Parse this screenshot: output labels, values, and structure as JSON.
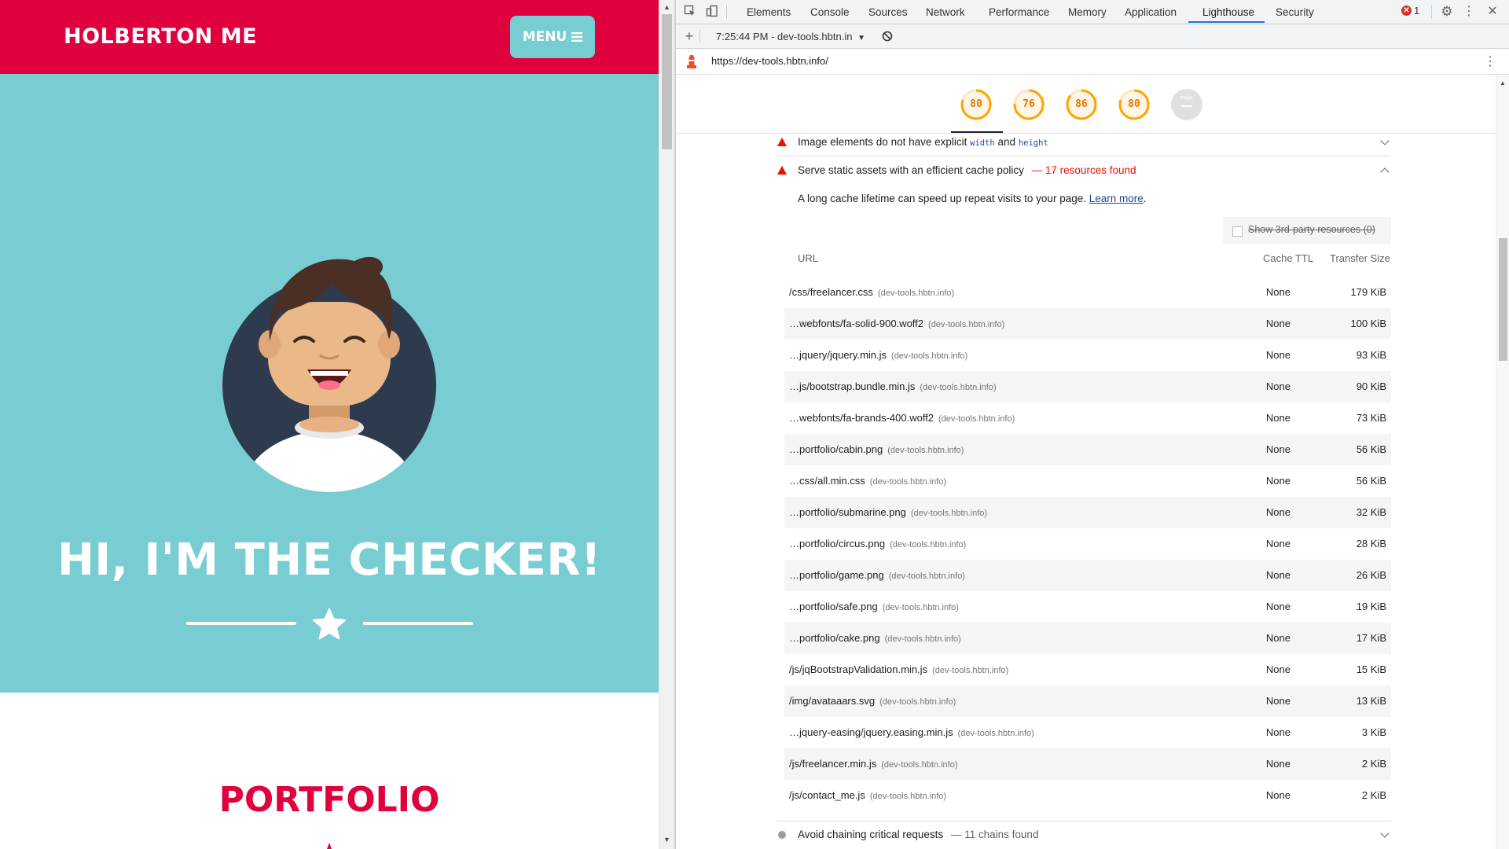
{
  "site": {
    "brand": "HOLBERTON ME",
    "menu_label": "MENU",
    "hero_title": "HI, I'M THE CHECKER!",
    "section_title": "PORTFOLIO"
  },
  "devtools": {
    "tabs": [
      "Elements",
      "Console",
      "Sources",
      "Network",
      "Performance",
      "Memory",
      "Application",
      "Lighthouse",
      "Security"
    ],
    "active_tab": "Lighthouse",
    "error_count": "1",
    "report_selector": "7:25:44 PM - dev-tools.hbtn.in",
    "url": "https://dev-tools.hbtn.info/",
    "scores": [
      "80",
      "76",
      "86",
      "80"
    ],
    "pwa_label": "PWA",
    "colors": {
      "score_average": "#e67700",
      "warn": "#eb0f00",
      "brand_red": "#e0003d",
      "hero_teal": "#78cdd2"
    }
  },
  "audit": {
    "prev_item": {
      "text_before": "Image elements do not have explicit",
      "code1": "width",
      "and": "and",
      "code2": "height"
    },
    "current": {
      "title": "Serve static assets with an efficient cache policy",
      "summary": "— 17 resources found",
      "description": "A long cache lifetime can speed up repeat visits to your page.",
      "learn_more": "Learn more",
      "period": ".",
      "third_party": "Show 3rd-party resources (0)",
      "col_url": "URL",
      "col_ttl": "Cache TTL",
      "col_size": "Transfer Size",
      "rows": [
        {
          "url": "/css/freelancer.css",
          "host": "(dev-tools.hbtn.info)",
          "ttl": "None",
          "size": "179 KiB"
        },
        {
          "url": "…webfonts/fa-solid-900.woff2",
          "host": "(dev-tools.hbtn.info)",
          "ttl": "None",
          "size": "100 KiB"
        },
        {
          "url": "…jquery/jquery.min.js",
          "host": "(dev-tools.hbtn.info)",
          "ttl": "None",
          "size": "93 KiB"
        },
        {
          "url": "…js/bootstrap.bundle.min.js",
          "host": "(dev-tools.hbtn.info)",
          "ttl": "None",
          "size": "90 KiB"
        },
        {
          "url": "…webfonts/fa-brands-400.woff2",
          "host": "(dev-tools.hbtn.info)",
          "ttl": "None",
          "size": "73 KiB"
        },
        {
          "url": "…portfolio/cabin.png",
          "host": "(dev-tools.hbtn.info)",
          "ttl": "None",
          "size": "56 KiB"
        },
        {
          "url": "…css/all.min.css",
          "host": "(dev-tools.hbtn.info)",
          "ttl": "None",
          "size": "56 KiB"
        },
        {
          "url": "…portfolio/submarine.png",
          "host": "(dev-tools.hbtn.info)",
          "ttl": "None",
          "size": "32 KiB"
        },
        {
          "url": "…portfolio/circus.png",
          "host": "(dev-tools.hbtn.info)",
          "ttl": "None",
          "size": "28 KiB"
        },
        {
          "url": "…portfolio/game.png",
          "host": "(dev-tools.hbtn.info)",
          "ttl": "None",
          "size": "26 KiB"
        },
        {
          "url": "…portfolio/safe.png",
          "host": "(dev-tools.hbtn.info)",
          "ttl": "None",
          "size": "19 KiB"
        },
        {
          "url": "…portfolio/cake.png",
          "host": "(dev-tools.hbtn.info)",
          "ttl": "None",
          "size": "17 KiB"
        },
        {
          "url": "/js/jqBootstrapValidation.min.js",
          "host": "(dev-tools.hbtn.info)",
          "ttl": "None",
          "size": "15 KiB"
        },
        {
          "url": "/img/avataaars.svg",
          "host": "(dev-tools.hbtn.info)",
          "ttl": "None",
          "size": "13 KiB"
        },
        {
          "url": "…jquery-easing/jquery.easing.min.js",
          "host": "(dev-tools.hbtn.info)",
          "ttl": "None",
          "size": "3 KiB"
        },
        {
          "url": "/js/freelancer.min.js",
          "host": "(dev-tools.hbtn.info)",
          "ttl": "None",
          "size": "2 KiB"
        },
        {
          "url": "/js/contact_me.js",
          "host": "(dev-tools.hbtn.info)",
          "ttl": "None",
          "size": "2 KiB"
        }
      ]
    },
    "next_item": {
      "title": "Avoid chaining critical requests",
      "summary": "— 11 chains found"
    }
  }
}
